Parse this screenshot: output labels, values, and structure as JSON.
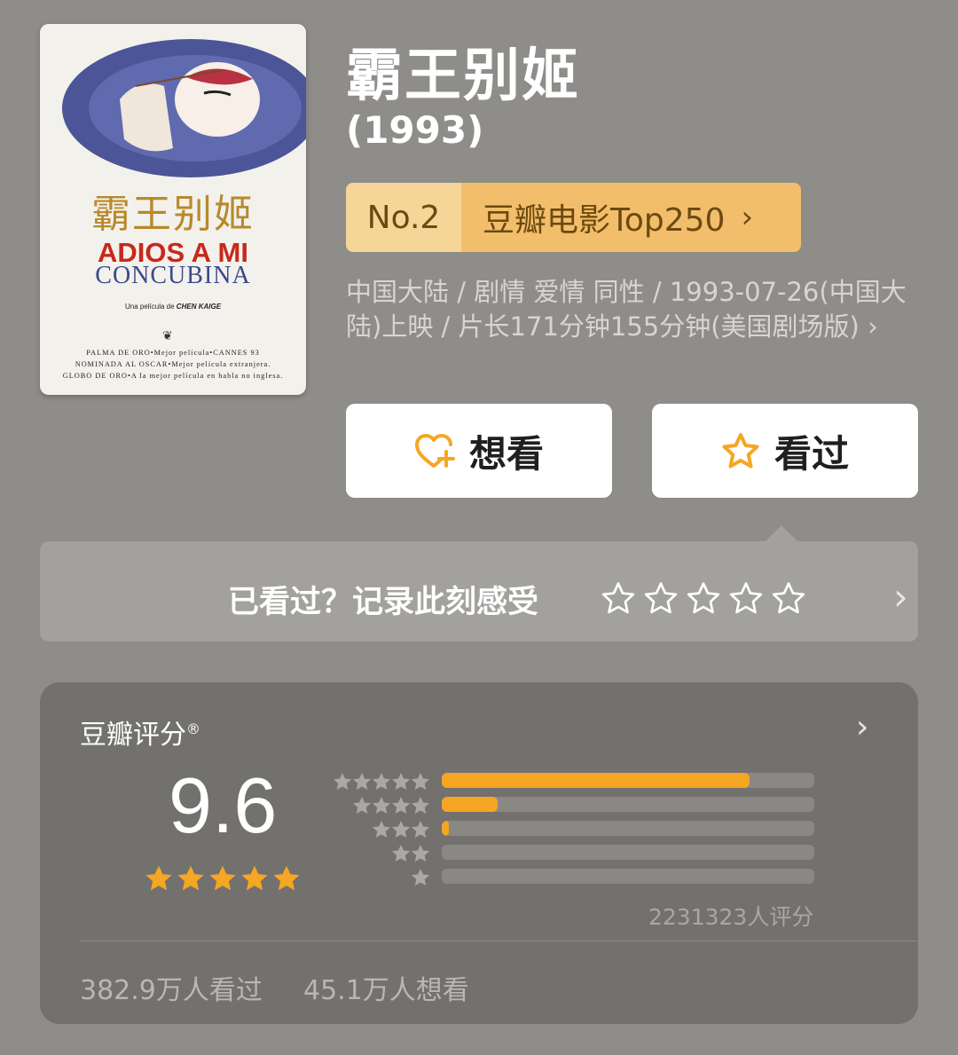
{
  "movie": {
    "title": "霸王别姬",
    "year": "(1993)",
    "meta": "中国大陆 / 剧情 爱情 同性 / 1993-07-26(中国大陆)上映 / 片长171分钟155分钟(美国剧场版) ›"
  },
  "poster": {
    "cn_title": "霸王别姬",
    "es_line1": "ADIOS A MI",
    "es_line2": "CONCUBINA",
    "byline_prefix": "Una película de",
    "byline_director": "CHEN KAIGE",
    "credit1": "PALMA DE ORO•Mejor película•CANNES 93",
    "credit2": "NOMINADA AL OSCAR•Mejor película extranjera.",
    "credit3": "GLOBO DE ORO•A la mejor película en habla no inglesa."
  },
  "rank": {
    "number": "No.2",
    "list": "豆瓣电影Top250",
    "chevron": "›"
  },
  "actions": {
    "want_label": "想看",
    "seen_label": "看过"
  },
  "record": {
    "prompt": "已看过？记录此刻感受",
    "chevron": "›"
  },
  "rating": {
    "heading": "豆瓣评分",
    "registered": "®",
    "score": "9.6",
    "count": "2231323人评分",
    "distribution": [
      {
        "stars": 5,
        "fraction": 0.825
      },
      {
        "stars": 4,
        "fraction": 0.15
      },
      {
        "stars": 3,
        "fraction": 0.02
      },
      {
        "stars": 2,
        "fraction": 0.0
      },
      {
        "stars": 1,
        "fraction": 0.0
      }
    ],
    "watched": "382.9万人看过",
    "wanted": "45.1万人想看",
    "chevron": "›"
  },
  "colors": {
    "accent": "#f5a623",
    "background": "#8f8d8a",
    "card": "#73716e"
  }
}
